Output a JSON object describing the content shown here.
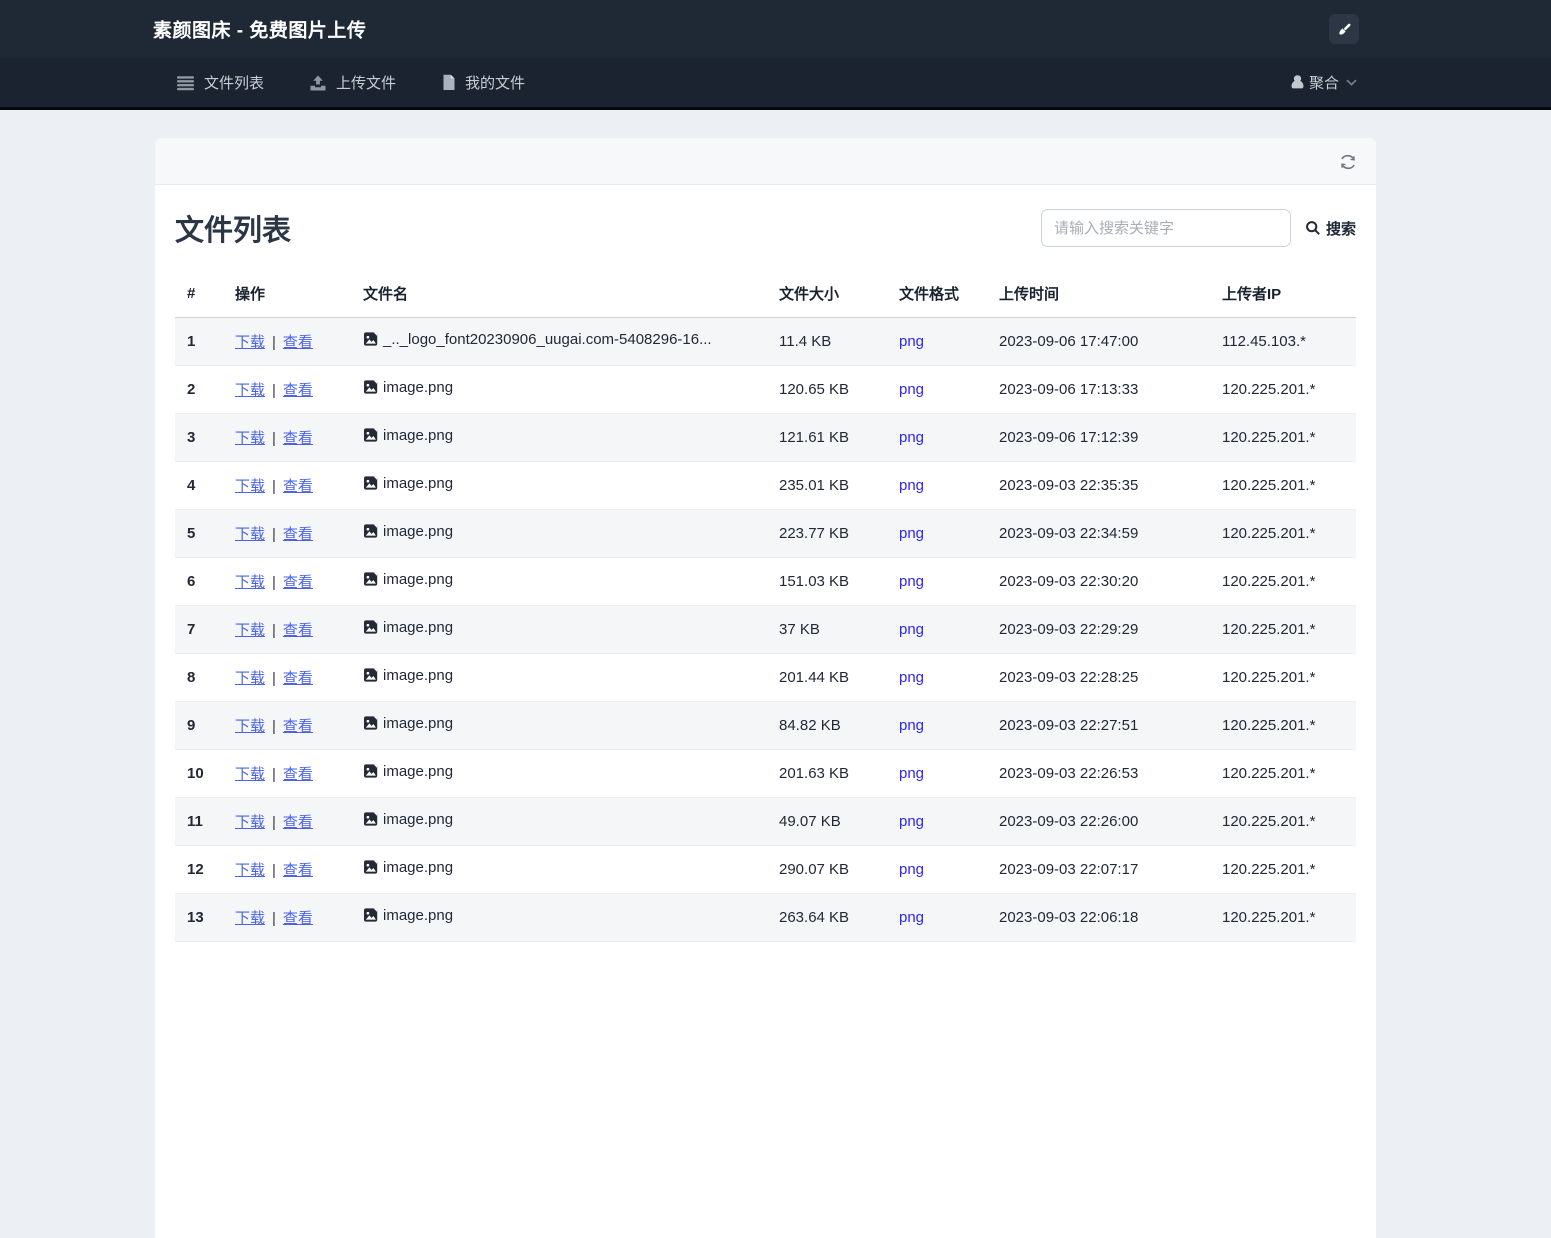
{
  "topbar": {
    "brand": "素颜图床 - 免费图片上传"
  },
  "navbar": {
    "items": [
      {
        "label": "文件列表",
        "icon": "list-icon"
      },
      {
        "label": "上传文件",
        "icon": "upload-icon"
      },
      {
        "label": "我的文件",
        "icon": "document-icon"
      }
    ],
    "user": {
      "label": "聚合",
      "icon": "penguin-icon"
    }
  },
  "panel": {
    "refresh_icon": "refresh-icon"
  },
  "main": {
    "title": "文件列表",
    "search": {
      "placeholder": "请输入搜索关键字",
      "button_label": "搜索",
      "icon": "search-icon"
    }
  },
  "table": {
    "columns": [
      "#",
      "操作",
      "文件名",
      "文件大小",
      "文件格式",
      "上传时间",
      "上传者IP"
    ],
    "action_labels": {
      "download": "下载",
      "view": "查看",
      "separator": "|"
    },
    "rows": [
      {
        "index": "1",
        "filename": "_.._logo_font20230906_uugai.com-5408296-16...",
        "size": "11.4 KB",
        "format": "png",
        "time": "2023-09-06 17:47:00",
        "ip": "112.45.103.*"
      },
      {
        "index": "2",
        "filename": "image.png",
        "size": "120.65 KB",
        "format": "png",
        "time": "2023-09-06 17:13:33",
        "ip": "120.225.201.*"
      },
      {
        "index": "3",
        "filename": "image.png",
        "size": "121.61 KB",
        "format": "png",
        "time": "2023-09-06 17:12:39",
        "ip": "120.225.201.*"
      },
      {
        "index": "4",
        "filename": "image.png",
        "size": "235.01 KB",
        "format": "png",
        "time": "2023-09-03 22:35:35",
        "ip": "120.225.201.*"
      },
      {
        "index": "5",
        "filename": "image.png",
        "size": "223.77 KB",
        "format": "png",
        "time": "2023-09-03 22:34:59",
        "ip": "120.225.201.*"
      },
      {
        "index": "6",
        "filename": "image.png",
        "size": "151.03 KB",
        "format": "png",
        "time": "2023-09-03 22:30:20",
        "ip": "120.225.201.*"
      },
      {
        "index": "7",
        "filename": "image.png",
        "size": "37 KB",
        "format": "png",
        "time": "2023-09-03 22:29:29",
        "ip": "120.225.201.*"
      },
      {
        "index": "8",
        "filename": "image.png",
        "size": "201.44 KB",
        "format": "png",
        "time": "2023-09-03 22:28:25",
        "ip": "120.225.201.*"
      },
      {
        "index": "9",
        "filename": "image.png",
        "size": "84.82 KB",
        "format": "png",
        "time": "2023-09-03 22:27:51",
        "ip": "120.225.201.*"
      },
      {
        "index": "10",
        "filename": "image.png",
        "size": "201.63 KB",
        "format": "png",
        "time": "2023-09-03 22:26:53",
        "ip": "120.225.201.*"
      },
      {
        "index": "11",
        "filename": "image.png",
        "size": "49.07 KB",
        "format": "png",
        "time": "2023-09-03 22:26:00",
        "ip": "120.225.201.*"
      },
      {
        "index": "12",
        "filename": "image.png",
        "size": "290.07 KB",
        "format": "png",
        "time": "2023-09-03 22:07:17",
        "ip": "120.225.201.*"
      },
      {
        "index": "13",
        "filename": "image.png",
        "size": "263.64 KB",
        "format": "png",
        "time": "2023-09-03 22:06:18",
        "ip": "120.225.201.*"
      }
    ]
  },
  "icons": {
    "theme_button": "brush-icon",
    "file_row": "image-file-icon",
    "dropdown": "chevron-down-icon"
  },
  "colors": {
    "topbar_bg": "#1f2936",
    "navbar_bg": "#1b2330",
    "page_bg": "#eceff3",
    "action_link_blue": "#4a63e4",
    "format_link_blue": "#2f25ee",
    "title_text": "#2b3647",
    "stripe_bg": "#f4f6f8"
  }
}
